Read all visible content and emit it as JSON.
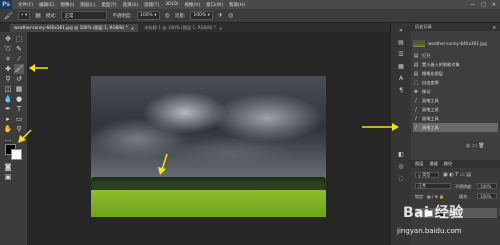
{
  "app": {
    "logo": "Ps"
  },
  "menubar": {
    "items": [
      "文件(F)",
      "编辑(E)",
      "图像(I)",
      "图层(L)",
      "类型(Y)",
      "选择(S)",
      "滤镜(T)",
      "3D(D)",
      "视图(V)",
      "窗口(W)",
      "帮助(H)"
    ],
    "window_buttons": [
      "—",
      "□",
      "✕"
    ]
  },
  "options_bar": {
    "mode_label": "模式:",
    "mode_value": "正常",
    "opacity_label": "不透明度:",
    "opacity_value": "100%",
    "flow_label": "流量:",
    "flow_value": "100%"
  },
  "tabs": [
    {
      "label": "weather-sunny-640x361.jpg @ 100% (图层 1, RGB/8) *",
      "close": "×"
    },
    {
      "label": "未标题-1 @ 100% (图层 1, RGB/8) *",
      "close": "×"
    }
  ],
  "history_panel": {
    "title": "历史记录",
    "snapshot": "weather-sunny-640x361.jpg",
    "steps": [
      "打开",
      "置入嵌入的智能对象",
      "栅格化图层",
      "自由变换",
      "移动",
      "画笔工具",
      "画笔工具",
      "画笔工具",
      "画笔工具"
    ],
    "selected_index": 8
  },
  "layers_panel": {
    "kind_label": "类型",
    "blend_mode": "正常",
    "opacity_label": "不透明度:",
    "opacity_value": "100%",
    "lock_label": "锁定:",
    "fill_label": "填充:",
    "fill_value": "100%",
    "layer_name": "图层 1"
  },
  "watermark": {
    "text": "Bai 经验",
    "url": "jingyan.baidu.com"
  },
  "colors": {
    "arrow": "#f5e500",
    "ps_logo_bg": "#1c3a57",
    "panel_selected": "#6a6a6a"
  }
}
